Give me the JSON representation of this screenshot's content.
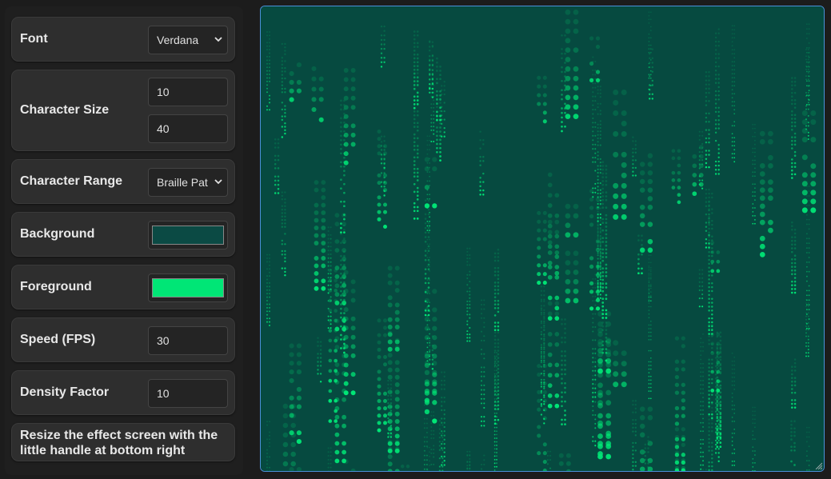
{
  "settings": {
    "font": {
      "label": "Font",
      "value": "Verdana"
    },
    "char_size": {
      "label": "Character Size",
      "min": "10",
      "max": "40"
    },
    "char_range": {
      "label": "Character Range",
      "value": "Braille Pat"
    },
    "background": {
      "label": "Background",
      "color": "#0b4a44"
    },
    "foreground": {
      "label": "Foreground",
      "color": "#00e676"
    },
    "speed": {
      "label": "Speed (FPS)",
      "value": "30"
    },
    "density": {
      "label": "Density Factor",
      "value": "10"
    },
    "hint": "Resize the effect screen with the little handle at bottom right"
  },
  "effect": {
    "background_color": "#064a40",
    "glyph_color": "#00e676"
  },
  "icons": {
    "select_chevron": "chevron-down-icon",
    "resize": "resize-handle-icon"
  }
}
